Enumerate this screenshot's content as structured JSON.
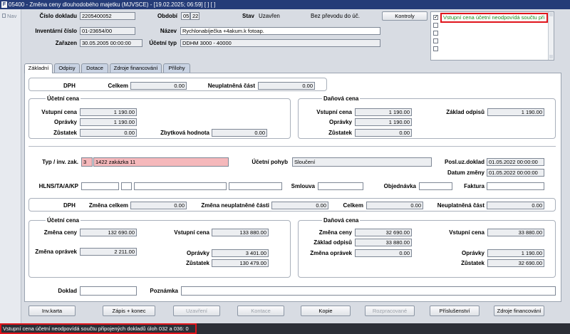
{
  "title_bar": {
    "text": "05400 - Změna ceny dlouhodobého majetku (MJVSCE) - [19.02.2025; 06:59]  [ ]  [ ]"
  },
  "side": {
    "nav": "Nav"
  },
  "header": {
    "cislo_dokladu_label": "Číslo dokladu",
    "cislo_dokladu": "2205400052",
    "obdobi_label": "Období",
    "obdobi_a": "05",
    "obdobi_b": "22",
    "stav_label": "Stav",
    "stav": "Uzavřen",
    "prevod": "Bez převodu do úč.",
    "kontroly_label": "Kontroly",
    "inv_cislo_label": "Inventární číslo",
    "inv_cislo": "01-23654/00",
    "nazev_label": "Název",
    "nazev": "Rychlonabíječka +4akum.k fotoap.",
    "zarazen_label": "Zařazen",
    "zarazen": "30.05.2005 00:00:00",
    "ucetni_typ_label": "Účetní typ",
    "ucetni_typ": "DDHM 3000 - 40000"
  },
  "control_list": {
    "items": [
      "Vstupní cena účetní neodpovídá součtu při"
    ],
    "check": "✓"
  },
  "tabs": [
    {
      "label": "Základní"
    },
    {
      "label": "Odpisy"
    },
    {
      "label": "Dotace"
    },
    {
      "label": "Zdroje financování"
    },
    {
      "label": "Přílohy"
    }
  ],
  "s1": {
    "dph_label": "DPH",
    "celkem_label": "Celkem",
    "celkem": "0.00",
    "neuplatnena_label": "Neuplatněná část",
    "neuplatnena": "0.00",
    "ucetni_title": "Účetní cena",
    "danova_title": "Daňová cena",
    "vstupni_label": "Vstupní cena",
    "opravky_label": "Oprávky",
    "zustatek_label": "Zůstatek",
    "u_vstupni": "1 190.00",
    "u_opravky": "1 190.00",
    "u_zustatek": "0.00",
    "zbytkova_label": "Zbytková hodnota",
    "zbytkova": "0.00",
    "d_vstupni": "1 190.00",
    "d_opravky": "1 190.00",
    "d_zustatek": "0.00",
    "zaklad_label": "Základ odpisů",
    "zaklad": "1 190.00"
  },
  "s2": {
    "typ_label": "Typ / inv. zak.",
    "typ": "3",
    "zakazka": "1422 zakázka 11",
    "pohyb_label": "Účetní pohyb",
    "pohyb": "Sloučení",
    "posl_label": "Posl.uz.doklad",
    "posl": "01.05.2022 00:00:00",
    "datum_label": "Datum změny",
    "datum": "01.05.2022 00:00:00",
    "hlns_label": "HLNS/TA/A/KP",
    "smlouva_label": "Smlouva",
    "objednavka_label": "Objednávka",
    "faktura_label": "Faktura"
  },
  "s3": {
    "dph_label": "DPH",
    "zmena_celkem_label": "Změna celkem",
    "zmena_celkem": "0.00",
    "zmena_neupl_label": "Změna neuplatněné části",
    "zmena_neupl": "0.00",
    "celkem_label": "Celkem",
    "celkem": "0.00",
    "neupl_label": "Neuplatněná část",
    "neupl": "0.00",
    "ucetni_title": "Účetní cena",
    "danova_title": "Daňová cena",
    "zmena_ceny_label": "Změna ceny",
    "zmena_opravek_label": "Změna oprávek",
    "vstupni_label": "Vstupní cena",
    "opravky_label": "Oprávky",
    "zustatek_label": "Zůstatek",
    "zaklad_label": "Základ odpisů",
    "u_zmena_ceny": "132 690.00",
    "u_zmena_opravek": "2 211.00",
    "u_vstupni": "133 880.00",
    "u_opravky": "3 401.00",
    "u_zustatek": "130 479.00",
    "d_zmena_ceny": "32 690.00",
    "d_zaklad": "33 880.00",
    "d_zmena_opravek": "0.00",
    "d_vstupni": "33 880.00",
    "d_opravky": "1 190.00",
    "d_zustatek": "32 690.00"
  },
  "bottom": {
    "doklad_label": "Doklad",
    "poznamka_label": "Poznámka"
  },
  "buttons": {
    "inv_karta": "Inv.karta",
    "zapis": "Zápis + konec",
    "uzavreni": "Uzavření",
    "kontace": "Kontace",
    "kopie": "Kopie",
    "rozprac": "Rozpracované",
    "prislusenstvi": "Příslušenství",
    "zdroje": "Zdroje financování"
  },
  "status": {
    "text": "Vstupní cena účetní neodpovídá součtu připojených dokladů úloh 032 a 036: 0"
  },
  "colors": {
    "title_bar": "#253c78",
    "status_bar": "#2c2f37",
    "highlight": "#e0141b",
    "pink_field": "#f5b8bb",
    "message_green": "#1b8c1b"
  }
}
